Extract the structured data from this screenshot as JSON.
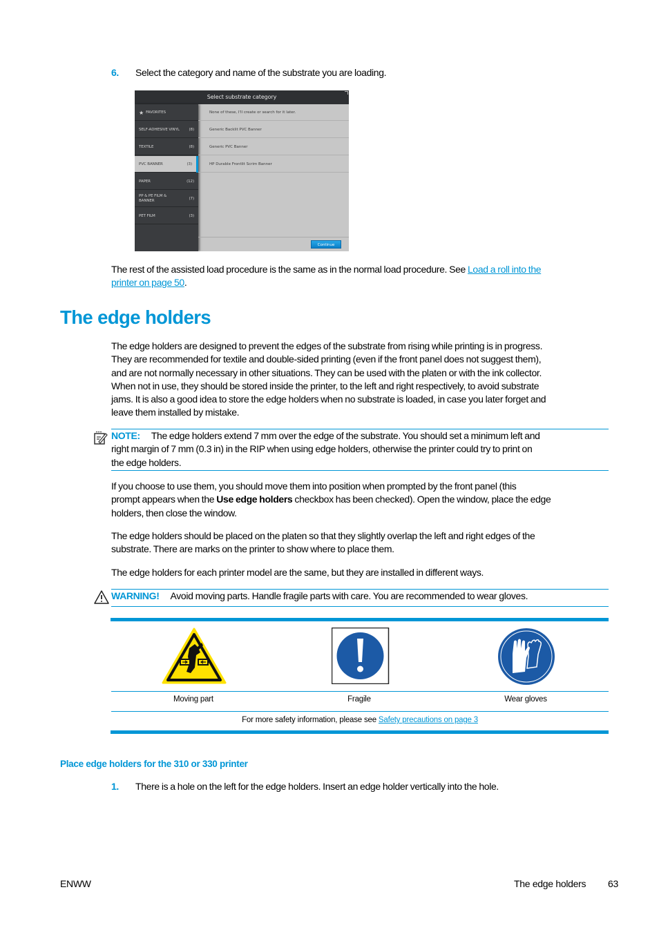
{
  "step6": {
    "number": "6.",
    "text": "Select the category and name of the substrate you are loading."
  },
  "printer_ui": {
    "title": "Select substrate category",
    "categories": [
      {
        "label": "FAVORITES",
        "count": "",
        "icon": "star-icon",
        "selected": false
      },
      {
        "label": "SELF-ADHESIVE VINYL",
        "count": "(8)",
        "selected": false
      },
      {
        "label": "TEXTILE",
        "count": "(8)",
        "selected": false
      },
      {
        "label": "PVC BANNER",
        "count": "(3)",
        "selected": true
      },
      {
        "label": "PAPER",
        "count": "(12)",
        "selected": false
      },
      {
        "label": "PP & PE FILM & BANNER",
        "count": "(7)",
        "selected": false
      },
      {
        "label": "PET FILM",
        "count": "(3)",
        "selected": false
      }
    ],
    "options": [
      "None of these, I'll create or search for it later.",
      "Generic Backlit PVC Banner",
      "Generic PVC Banner",
      "HP Durable Frontlit Scrim Banner"
    ],
    "continue_label": "Continue"
  },
  "rest_paragraph": {
    "before": "The rest of the assisted load procedure is the same as in the normal load procedure. See ",
    "link_line1": "Load a roll into the",
    "link_line2": "printer on page 50",
    "after": "."
  },
  "section_title": "The edge holders",
  "intro_paragraph": [
    "The edge holders are designed to prevent the edges of the substrate from rising while printing is in progress.",
    "They are recommended for textile and double-sided printing (even if the front panel does not suggest them),",
    "and are not normally necessary in other situations. They can be used with the platen or with the ink collector.",
    "When not in use, they should be stored inside the printer, to the left and right respectively, to avoid substrate",
    "jams. It is also a good idea to store the edge holders when no substrate is loaded, in case you later forget and",
    "leave them installed by mistake."
  ],
  "note": {
    "icon": "note-icon",
    "label": "NOTE:",
    "lines": [
      "The edge holders extend 7 mm over the edge of the substrate. You should set a minimum left and",
      "right margin of 7 mm (0.3 in) in the RIP when using edge holders, otherwise the printer could try to print on",
      "the edge holders."
    ]
  },
  "use_paragraph": {
    "line1": "If you choose to use them, you should move them into position when prompted by the front panel (this",
    "line2_before": "prompt appears when the ",
    "line2_bold": "Use edge holders",
    "line2_after": " checkbox has been checked). Open the window, place the edge",
    "line3": "holders, then close the window."
  },
  "placement_paragraph": [
    "The edge holders should be placed on the platen so that they slightly overlap the left and right edges of the",
    "substrate. There are marks on the printer to show where to place them."
  ],
  "models_paragraph": "The edge holders for each printer model are the same, but they are installed in different ways.",
  "warning": {
    "icon": "warning-triangle-icon",
    "label": "WARNING!",
    "text": "Avoid moving parts. Handle fragile parts with care. You are recommended to wear gloves."
  },
  "safety_table": {
    "symbols": [
      {
        "icon": "moving-part-hazard-icon",
        "label": "Moving part"
      },
      {
        "icon": "fragile-exclamation-icon",
        "label": "Fragile"
      },
      {
        "icon": "wear-gloves-icon",
        "label": "Wear gloves"
      }
    ],
    "footer_text": "For more safety information, please see ",
    "footer_link": "Safety precautions on page 3"
  },
  "subsection_title": "Place edge holders for the 310 or 330 printer",
  "step1": {
    "number": "1.",
    "text": "There is a hole on the left for the edge holders. Insert an edge holder vertically into the hole."
  },
  "page_footer": {
    "left": "ENWW",
    "section": "The edge holders",
    "page_number": "63"
  },
  "colors": {
    "accent": "#0096d6",
    "ui_dark": "#3a3c3f",
    "ui_light": "#c7c7c7",
    "hazard_yellow": "#ffe100",
    "mandatory_blue": "#1c5aa6"
  }
}
